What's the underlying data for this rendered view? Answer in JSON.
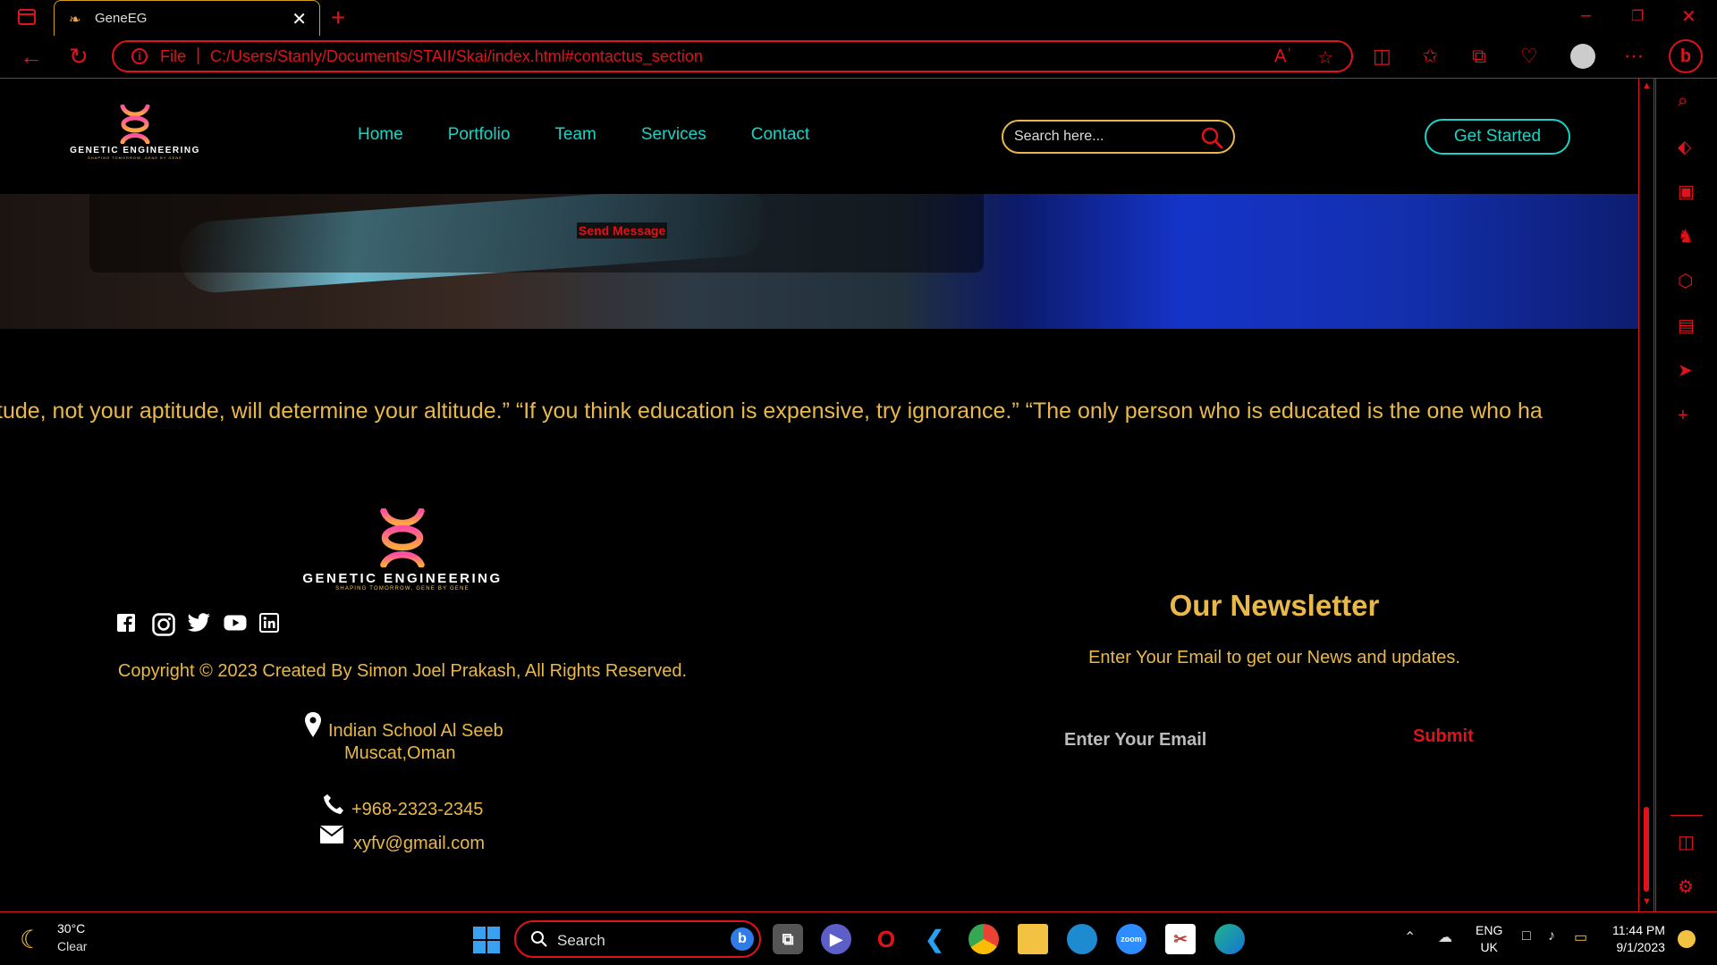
{
  "browser": {
    "tab_title": "GeneEG",
    "url_scheme_label": "File",
    "url_path": "C:/Users/Stanly/Documents/STAII/Skai/index.html#contactus_section",
    "colors": {
      "accent": "#e0121a",
      "tab_border": "#d4a017"
    }
  },
  "site": {
    "logo_name": "GENETIC ENGINEERING",
    "logo_tagline": "SHAPING TOMORROW, GENE BY GENE",
    "nav": [
      "Home",
      "Portfolio",
      "Team",
      "Services",
      "Contact"
    ],
    "search_placeholder": "Search here...",
    "cta_label": "Get Started",
    "colors": {
      "nav": "#19d3c5",
      "gold": "#e9b84a"
    }
  },
  "contact_form": {
    "send_label": "Send Message"
  },
  "quotes_marquee": "tude, not your aptitude, will determine your altitude.” “If you think education is expensive, try ignorance.” “The only person who is educated is the one who ha",
  "footer": {
    "logo_name": "GENETIC ENGINEERING",
    "logo_tagline": "SHAPING TOMORROW, GENE BY GENE",
    "social": [
      "facebook-icon",
      "instagram-icon",
      "twitter-icon",
      "youtube-icon",
      "linkedin-icon"
    ],
    "copyright": "Copyright © 2023 Created By Simon Joel Prakash, All Rights Reserved.",
    "address_line1": "Indian School Al Seeb",
    "address_line2": "Muscat,Oman",
    "phone": "+968-2323-2345",
    "email": "xyfv@gmail.com"
  },
  "newsletter": {
    "title": "Our Newsletter",
    "subtitle": "Enter Your Email to get our News and updates.",
    "email_placeholder": "Enter Your Email",
    "submit_label": "Submit"
  },
  "taskbar": {
    "temperature": "30°C",
    "condition": "Clear",
    "search_label": "Search",
    "lang_line1": "ENG",
    "lang_line2": "UK",
    "time": "11:44 PM",
    "date": "9/1/2023"
  }
}
